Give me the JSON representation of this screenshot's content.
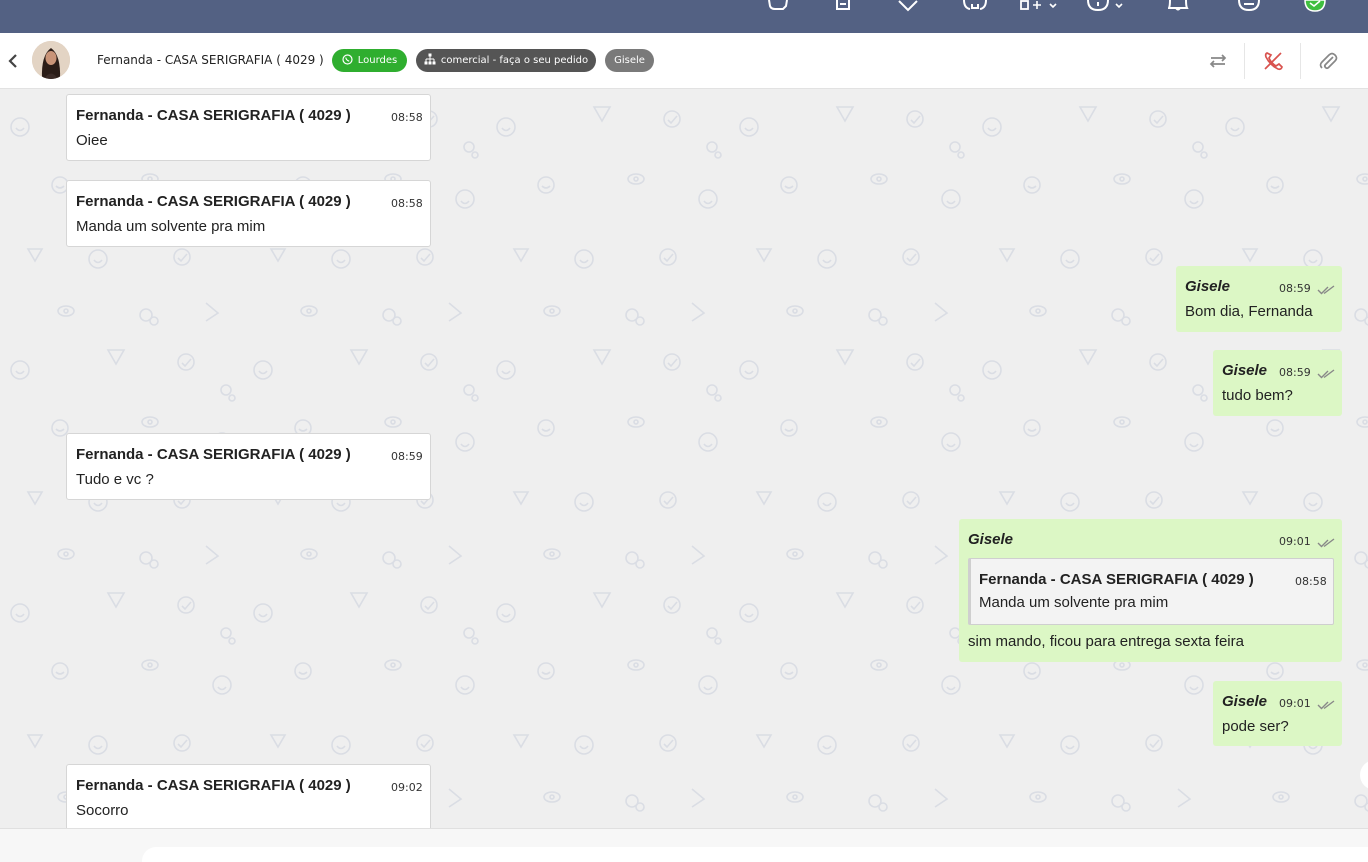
{
  "colors": {
    "topbar": "#536183",
    "incoming_bubble": "#ffffff",
    "outgoing_bubble": "#dcf7c5",
    "badge_connection": "#2fae2f",
    "badge_queue": "#555555",
    "badge_user": "#7a7a7a",
    "end_call_icon": "#d9534f"
  },
  "topbar": {
    "icons": [
      "chat-icon",
      "document-icon",
      "heart-icon",
      "phone-icon",
      "apps-icon",
      "info-icon",
      "bell-icon",
      "user-icon",
      "status-icon"
    ]
  },
  "header": {
    "contact_name": "Fernanda - CASA SERIGRAFIA ( 4029 )",
    "connection_badge": "Lourdes",
    "queue_badge": "comercial - faça o seu pedido",
    "user_badge": "Gisele",
    "actions": [
      "transfer-icon",
      "end-call-icon",
      "attach-icon"
    ]
  },
  "messages": [
    {
      "direction": "in",
      "sender": "Fernanda - CASA SERIGRAFIA ( 4029 )",
      "time": "08:58",
      "text": "Oiee"
    },
    {
      "direction": "in",
      "sender": "Fernanda - CASA SERIGRAFIA ( 4029 )",
      "time": "08:58",
      "text": "Manda um solvente pra mim"
    },
    {
      "direction": "out",
      "sender": "Gisele",
      "time": "08:59",
      "text": "Bom dia, Fernanda"
    },
    {
      "direction": "out",
      "sender": "Gisele",
      "time": "08:59",
      "text": "tudo bem?"
    },
    {
      "direction": "in",
      "sender": "Fernanda - CASA SERIGRAFIA ( 4029 )",
      "time": "08:59",
      "text": "Tudo e vc ?"
    },
    {
      "direction": "out",
      "sender": "Gisele",
      "time": "09:01",
      "text": "sim mando, ficou para entrega sexta feira",
      "quote": {
        "sender": "Fernanda - CASA SERIGRAFIA ( 4029 )",
        "time": "08:58",
        "text": "Manda um solvente pra mim"
      }
    },
    {
      "direction": "out",
      "sender": "Gisele",
      "time": "09:01",
      "text": "pode ser?"
    },
    {
      "direction": "in",
      "sender": "Fernanda - CASA SERIGRAFIA ( 4029 )",
      "time": "09:02",
      "text": "Socorro"
    }
  ]
}
